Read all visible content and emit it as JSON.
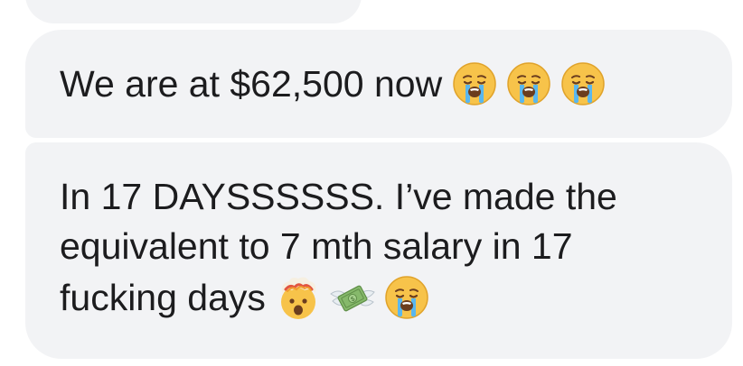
{
  "messages": [
    {
      "text": "We are at $62,500 now",
      "emojis": [
        "loudly-crying-face-icon",
        "loudly-crying-face-icon",
        "loudly-crying-face-icon"
      ]
    },
    {
      "lines": [
        "In 17 DAYSSSSSS. I’ve made the",
        "equivalent to 7 mth salary in 17",
        "fucking days"
      ],
      "emojis": [
        "exploding-head-icon",
        "money-with-wings-icon",
        "loudly-crying-face-icon"
      ]
    }
  ],
  "colors": {
    "bubble": "#f2f3f5",
    "text": "#1c1c1e"
  }
}
